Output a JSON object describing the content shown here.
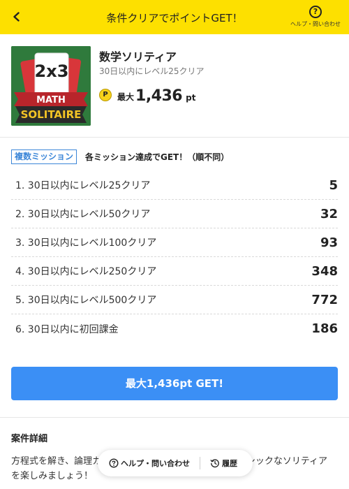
{
  "header": {
    "title": "条件クリアでポイントGET！",
    "help_label": "ヘルプ・問い合わせ",
    "bg_color": "#fde000"
  },
  "campaign": {
    "app_name": "数学ソリティア",
    "subtitle": "30日以内にレベル25クリア",
    "icon_text_top": "2x3",
    "icon_text_math": "MATH",
    "icon_text_solitaire": "SOLITAIRE",
    "coin_glyph": "P",
    "max_label": "最大",
    "max_value": "1,436",
    "max_unit": "pt"
  },
  "missions": {
    "tag": "複数ミッション",
    "heading": "各ミッション達成でGET！（順不同）",
    "items": [
      {
        "label": "1. 30日以内にレベル25クリア",
        "points": "5"
      },
      {
        "label": "2. 30日以内にレベル50クリア",
        "points": "32"
      },
      {
        "label": "3. 30日以内にレベル100クリア",
        "points": "93"
      },
      {
        "label": "4. 30日以内にレベル250クリア",
        "points": "348"
      },
      {
        "label": "5. 30日以内にレベル500クリア",
        "points": "772"
      },
      {
        "label": "6. 30日以内に初回課金",
        "points": "186"
      }
    ]
  },
  "cta": {
    "label": "最大1,436pt GET!",
    "color": "#3b8ff5"
  },
  "details": {
    "title": "案件詳細",
    "text_line1_left": "方程式を解き、論理カ",
    "text_line1_right": "ラシックなソリティア",
    "text_line2": "を楽しみましょう！"
  },
  "float_bar": {
    "help_label": "ヘルプ・問い合わせ",
    "history_label": "履歴"
  }
}
